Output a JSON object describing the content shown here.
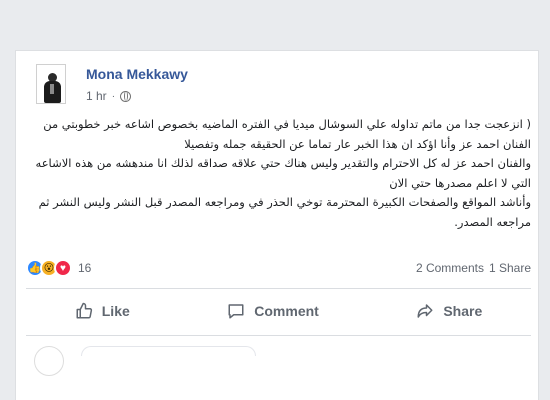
{
  "post": {
    "author": "Mona Mekkawy",
    "time": "1 hr",
    "separator": "·",
    "privacy_icon": "globe-icon",
    "paragraphs": [
      "( انزعجت جدا من ماتم تداوله علي السوشال ميديا في الفتره الماضيه بخصوص اشاعه خبر خطوبتي من الفنان احمد عز وأنا اؤكد ان هذا الخبر عار تماما عن الحقيقه جمله وتفصيلا",
      "والفنان احمد عز له كل الاحترام والتقدير وليس هناك حتي علاقه صداقه لذلك انا مندهشه من هذه الاشاعه التي لا اعلم مصدرها حتي الان",
      "وأناشد المواقع والصفحات الكبيرة المحترمة توخي الحذر في ومراجعه المصدر قبل النشر وليس النشر ثم مراجعه المصدر."
    ]
  },
  "stats": {
    "reactions_count": "16",
    "comments": "2 Comments",
    "shares": "1 Share",
    "reaction_icons": [
      "like-icon",
      "wow-icon",
      "love-icon"
    ]
  },
  "actions": {
    "like": "Like",
    "comment": "Comment",
    "share": "Share"
  },
  "colors": {
    "name": "#365899",
    "meta": "#616770",
    "like_react": "#2d88ff",
    "wow_react": "#f7b125",
    "love_react": "#f0284a"
  }
}
